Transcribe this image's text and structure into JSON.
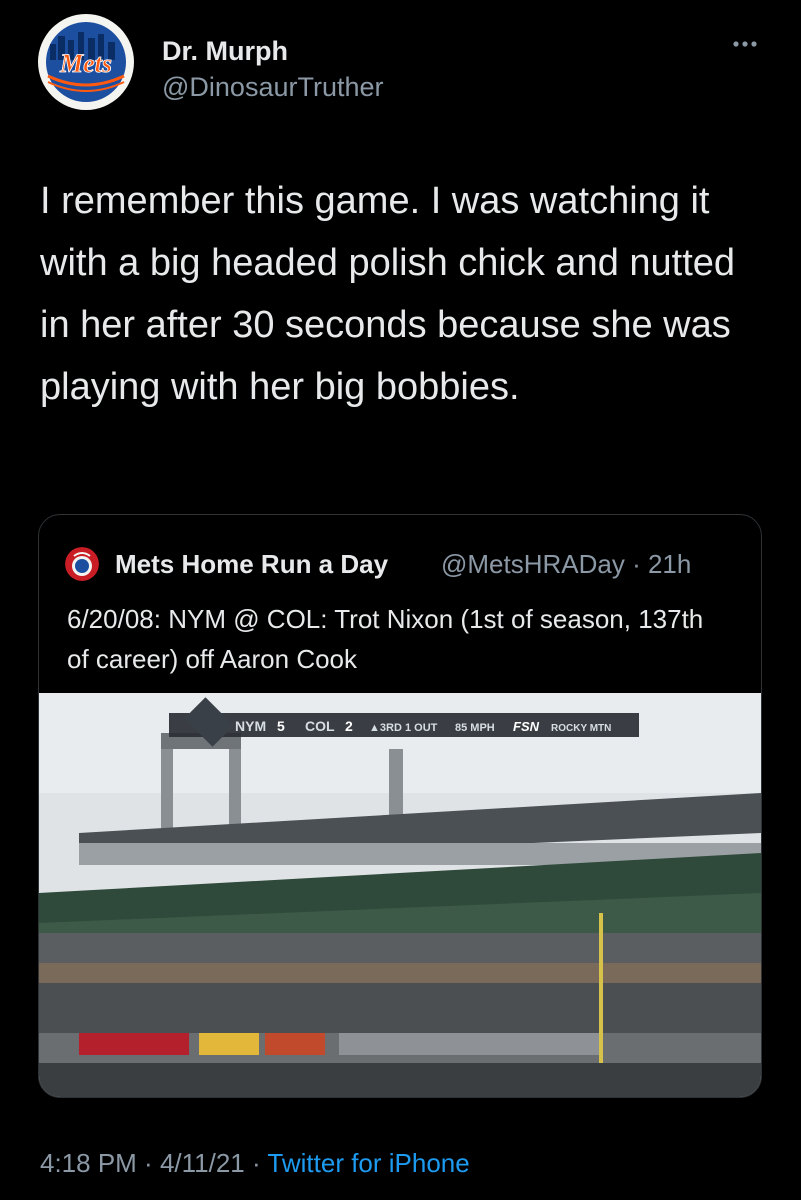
{
  "author": {
    "name": "Dr. Murph",
    "handle": "@DinosaurTruther",
    "avatar_text": "Mets"
  },
  "tweet": {
    "text": "I remember this game. I was watching it with a big headed polish chick and nutted in her after 30 seconds because she was playing with her big bobbies."
  },
  "quoted": {
    "name": "Mets Home Run a Day",
    "handle_time": "@MetsHRADay · 21h",
    "text": "6/20/08: NYM @ COL: Trot Nixon (1st of season, 137th of career) off Aaron Cook",
    "video": {
      "score_away_team": "NYM",
      "score_away": "5",
      "score_home_team": "COL",
      "score_home": "2",
      "inning": "▲3RD",
      "outs": "1 OUT",
      "pitch": "85 MPH",
      "network": "FSN",
      "network_region": "ROCKY MTN"
    }
  },
  "footer": {
    "time": "4:18 PM",
    "sep1": " · ",
    "date": "4/11/21",
    "sep2": " · ",
    "source": "Twitter for iPhone"
  },
  "colors": {
    "background": "#000000",
    "text": "#e7e9ea",
    "secondary": "#8b98a5",
    "link": "#1d9bf0",
    "mets_blue": "#1d4fa0",
    "mets_orange": "#ff5910"
  }
}
